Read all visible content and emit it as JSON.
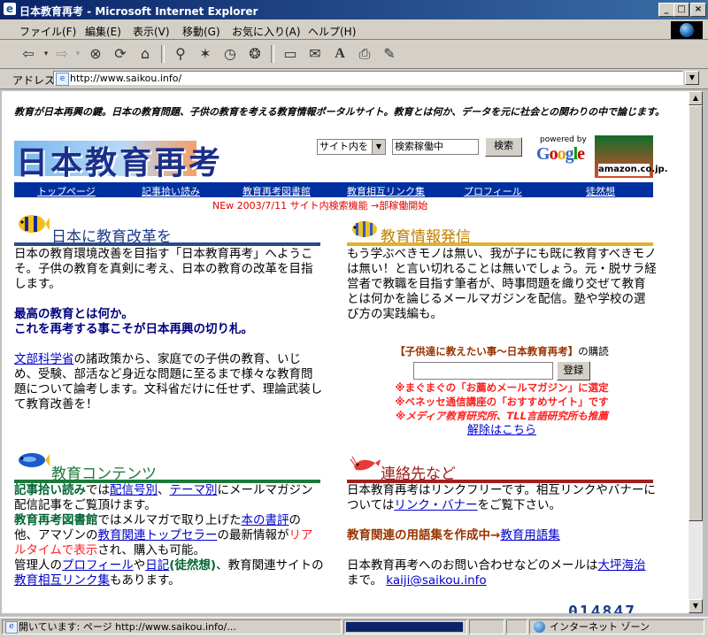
{
  "window": {
    "title": "日本教育再考 - Microsoft Internet Explorer",
    "buttons": {
      "minimize": "_",
      "maximize": "□",
      "close": "×"
    }
  },
  "menu": [
    "ファイル(F)",
    "編集(E)",
    "表示(V)",
    "移動(G)",
    "お気に入り(A)",
    "ヘルプ(H)"
  ],
  "toolbar_icons": [
    "back-icon",
    "forward-icon",
    "stop-icon",
    "refresh-icon",
    "home-icon",
    "search-icon",
    "favorites-icon",
    "history-icon",
    "channels-icon",
    "fullscreen-icon",
    "mail-icon",
    "font-icon",
    "print-icon",
    "edit-icon"
  ],
  "address": {
    "label": "アドレス",
    "url": "http://www.saikou.info/"
  },
  "page": {
    "intro": "教育が日本再興の鍵。日本の教育問題、子供の教育を考える教育情報ポータルサイト。教育とは何か、データを元に社会との関わりの中で論じます。",
    "logo_text": "日本教育再考",
    "search": {
      "scope": "サイト内を",
      "placeholder": "検索稼働中",
      "button": "検索"
    },
    "google": {
      "powered_by": "powered by",
      "name": "Google"
    },
    "amazon": {
      "label": "amazon.co.jp."
    },
    "nav": [
      "トップページ",
      "記事拾い読み",
      "教育再考図書館",
      "教育相互リンク集",
      "プロフィール",
      "徒然想"
    ],
    "news": "NEw 2003/7/11 サイト内検索機能 →部稼働開始",
    "sections": {
      "reform": {
        "title": "日本に教育改革を",
        "p1": "日本の教育環境改善を目指す「日本教育再考」へようこそ。子供の教育を真剣に考え、日本の教育の改革を目指します。",
        "p2_line1": "最高の教育とは何か。",
        "p2_line2": "これを再考する事こそが日本再興の切り札。",
        "p3_link": "文部科学省",
        "p3_rest": "の諸政策から、家庭での子供の教育、いじめ、受験、部活など身近な問題に至るまで様々な教育問題について論考します。文科省だけに任せず、理論武装して教育改善を！"
      },
      "info": {
        "title": "教育情報発信",
        "p1": "もう学ぶべきモノは無い、我が子にも既に教育すべきモノは無い！と言い切れることは無いでしょう。元・脱サラ経営者で教職を目指す筆者が、時事問題を織り交ぜて教育とは何かを論じるメールマガジンを配信。塾や学校の選び方の実践編も。",
        "mag_title": "【子供達に教えたい事～日本教育再考】",
        "mag_suffix": "の購読",
        "register": "登録",
        "rec1": "※まぐまぐの「お薦めメールマガジン」に選定",
        "rec2": "※ベネッセ通信講座の「おすすめサイト」です",
        "rec3": "※メディア教育研究所、TLL言語研究所も推薦",
        "unsubscribe": "解除はこちら"
      },
      "contents": {
        "title": "教育コンテンツ",
        "a_label": "記事拾い読み",
        "a_mid1": "では",
        "a_link1": "配信号別",
        "a_sep": "、",
        "a_link2": "テーマ別",
        "a_rest": "にメールマガジン配信記事をご覧頂けます。",
        "b_label": "教育再考図書館",
        "b_mid1": "ではメルマガで取り上げた",
        "b_link1": "本の書評",
        "b_mid2": "の他、アマゾンの",
        "b_link2": "教育関連トップセラー",
        "b_mid3": "の最新情報が",
        "b_red": "リアルタイムで表示",
        "b_rest": "され、購入も可能。",
        "c_pre": "管理人の",
        "c_link1": "プロフィール",
        "c_mid": "や",
        "c_link2": "日記",
        "c_label": "(徒然想)",
        "c_mid2": "、教育関連サイトの",
        "c_link3": "教育相互リンク集",
        "c_rest": "もあります。"
      },
      "contact": {
        "title": "連絡先など",
        "p1_pre": "日本教育再考はリンクフリーです。相互リンクやバナーについては",
        "p1_link": "リンク・バナー",
        "p1_rest": "をご覧下さい。",
        "p2_pre": "教育関連の用語集を作成中→",
        "p2_link": "教育用語集",
        "p3_pre": "日本教育再考へのお問い合わせなどのメールは",
        "p3_link1": "大坪海治",
        "p3_mid": "まで。",
        "p3_email": "kaiji@saikou.info"
      }
    },
    "counter": "014847"
  },
  "status": {
    "text": "開いています: ページ http://www.saikou.info/...",
    "zone": "インターネット ゾーン"
  },
  "colors": {
    "nav_bg": "#0030a0",
    "reform_bar": "#2a4a8a",
    "info_bar": "#e0b030",
    "contents_bar": "#1a7a3a",
    "contact_bar": "#a02020"
  }
}
